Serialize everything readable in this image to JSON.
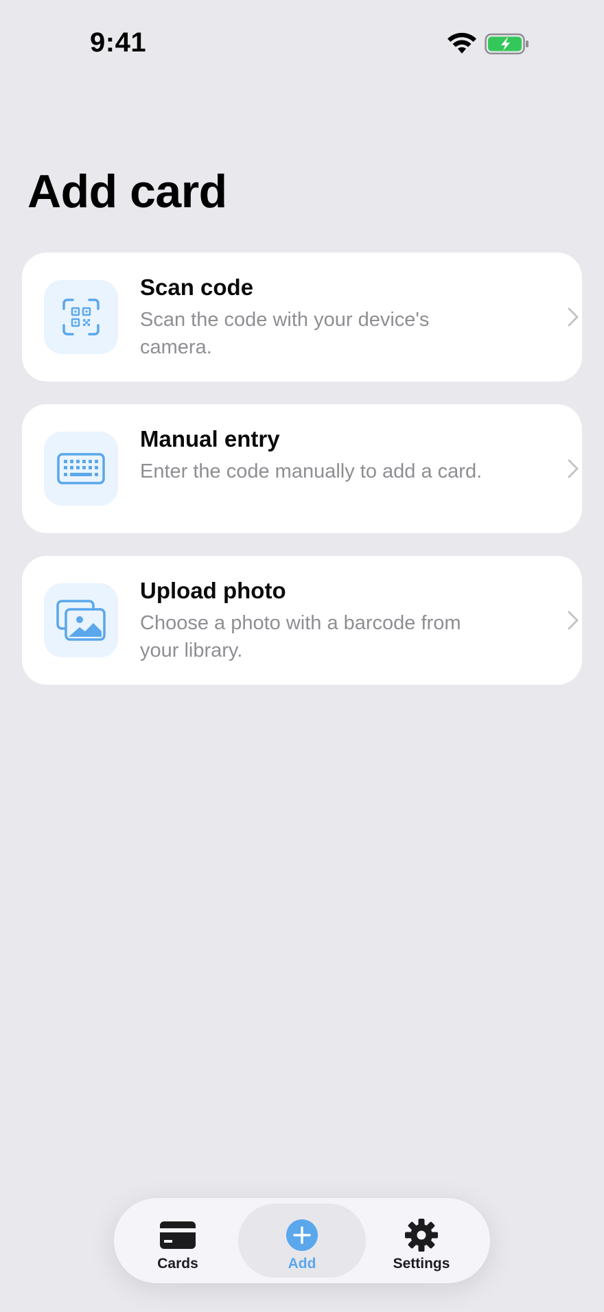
{
  "status_bar": {
    "time": "9:41",
    "icons": [
      "wifi-icon",
      "battery-charging-icon"
    ]
  },
  "page": {
    "title": "Add card"
  },
  "options": [
    {
      "title": "Scan code",
      "description": "Scan the code with your device's camera.",
      "icon": "qr-scan-icon"
    },
    {
      "title": "Manual entry",
      "description": "Enter the code manually to add a card.",
      "icon": "keyboard-icon"
    },
    {
      "title": "Upload photo",
      "description": "Choose a photo with a barcode from your library.",
      "icon": "photo-library-icon"
    }
  ],
  "tab_bar": {
    "selected": "Add",
    "tabs": [
      {
        "label": "Cards",
        "icon": "card-icon"
      },
      {
        "label": "Add",
        "icon": "plus-circle-icon"
      },
      {
        "label": "Settings",
        "icon": "gear-icon"
      }
    ]
  },
  "colors": {
    "background": "#E8E8ED",
    "accent": "#5AA7EC",
    "icon_tile": "#EAF4FE",
    "secondary_text": "#8E8E93",
    "battery_green": "#34C759"
  }
}
